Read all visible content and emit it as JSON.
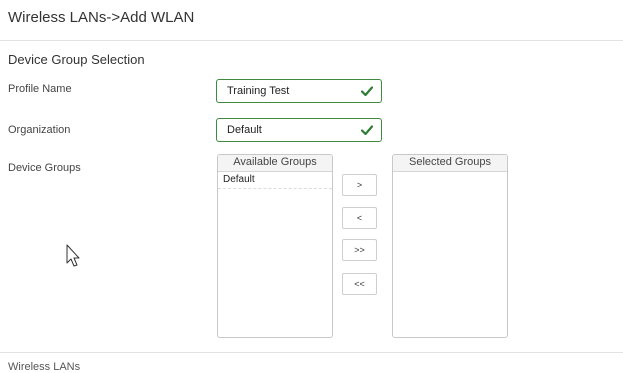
{
  "header": {
    "title": "Wireless LANs->Add WLAN"
  },
  "section": {
    "title": "Device Group Selection"
  },
  "form": {
    "profile_name": {
      "label": "Profile Name",
      "value": "Training Test",
      "valid": true
    },
    "organization": {
      "label": "Organization",
      "value": "Default",
      "valid": true
    },
    "device_groups": {
      "label": "Device Groups"
    }
  },
  "groups": {
    "available": {
      "header": "Available Groups",
      "items": [
        "Default"
      ]
    },
    "selected": {
      "header": "Selected Groups",
      "items": []
    },
    "buttons": {
      "move_right": ">",
      "move_left": "<",
      "move_all_right": ">>",
      "move_all_left": "<<"
    }
  },
  "footer": {
    "next_section": "Wireless LANs"
  },
  "colors": {
    "valid_border": "#3f8a3f",
    "check": "#2e7d32"
  },
  "icons": {
    "valid": "checkmark-icon",
    "pointer": "mouse-pointer-icon"
  }
}
